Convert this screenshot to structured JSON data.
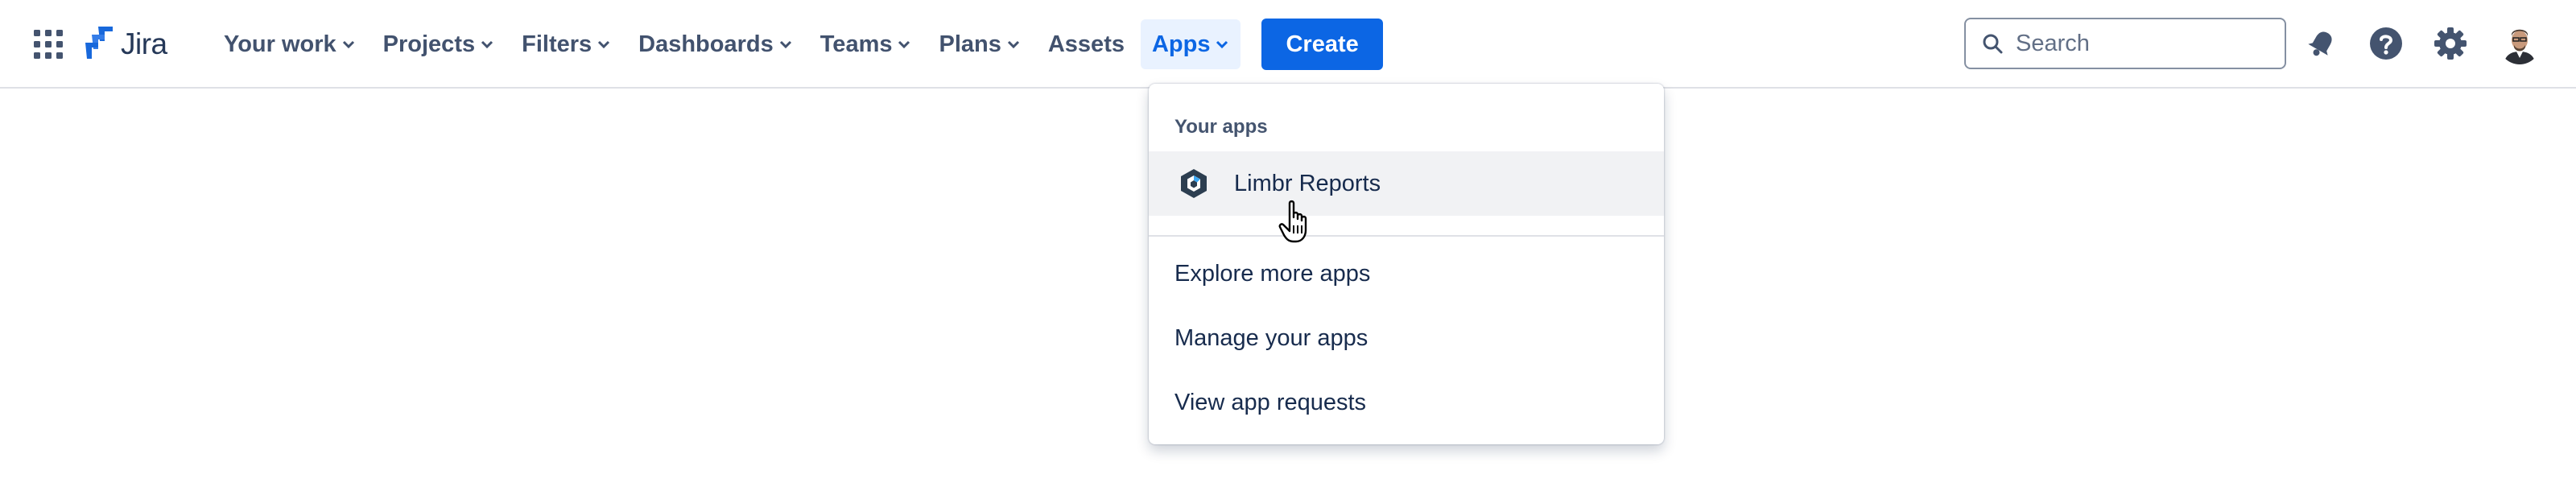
{
  "brand": {
    "name": "Jira",
    "color": "#1868db"
  },
  "nav": {
    "items": [
      {
        "label": "Your work",
        "has_chevron": true
      },
      {
        "label": "Projects",
        "has_chevron": true
      },
      {
        "label": "Filters",
        "has_chevron": true
      },
      {
        "label": "Dashboards",
        "has_chevron": true
      },
      {
        "label": "Teams",
        "has_chevron": true
      },
      {
        "label": "Plans",
        "has_chevron": true
      },
      {
        "label": "Assets",
        "has_chevron": false
      },
      {
        "label": "Apps",
        "has_chevron": true,
        "active": true
      }
    ],
    "create_label": "Create"
  },
  "search": {
    "placeholder": "Search"
  },
  "icons": {
    "app_switcher": "grid-icon",
    "notifications": "bell-icon",
    "help": "help-icon",
    "settings": "gear-icon",
    "avatar": "user-avatar"
  },
  "apps_menu": {
    "heading": "Your apps",
    "apps": [
      {
        "label": "Limbr Reports",
        "icon": "hexagon-icon"
      }
    ],
    "links": [
      {
        "label": "Explore more apps"
      },
      {
        "label": "Manage your apps"
      },
      {
        "label": "View app requests"
      }
    ]
  },
  "colors": {
    "accent": "#0c66e4",
    "active_bg": "#e9f2ff",
    "hover_bg": "#f1f2f4",
    "nav_text": "#42526e"
  }
}
